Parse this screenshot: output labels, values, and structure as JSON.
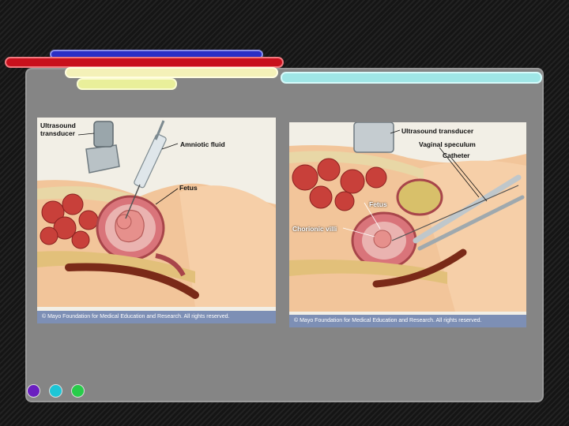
{
  "slide": {
    "colors": {
      "blue": "#2a2fc6",
      "red": "#c8101c",
      "cream": "#f4f1b8",
      "cyan": "#9fe6e6",
      "yellow": "#e9ef9a",
      "panel": "#858585"
    }
  },
  "figure_left": {
    "labels": {
      "ultrasound_transducer": "Ultrasound\ntransducer",
      "amniotic_fluid": "Amniotic fluid",
      "fetus": "Fetus"
    },
    "credit": "© Mayo Foundation for Medical Education and Research.  All rights reserved."
  },
  "figure_right": {
    "labels": {
      "ultrasound_transducer": "Ultrasound transducer",
      "vaginal_speculum": "Vaginal speculum",
      "catheter": "Catheter",
      "fetus": "Fetus",
      "chorionic_villi": "Chorionic villi"
    },
    "credit": "© Mayo Foundation for Medical Education and Research.  All rights reserved."
  },
  "nav_dots": [
    {
      "icon": "purple-dot-icon",
      "color": "#6a1fc0"
    },
    {
      "icon": "cyan-dot-icon",
      "color": "#1dc6d6"
    },
    {
      "icon": "green-dot-icon",
      "color": "#28cc4a"
    }
  ]
}
